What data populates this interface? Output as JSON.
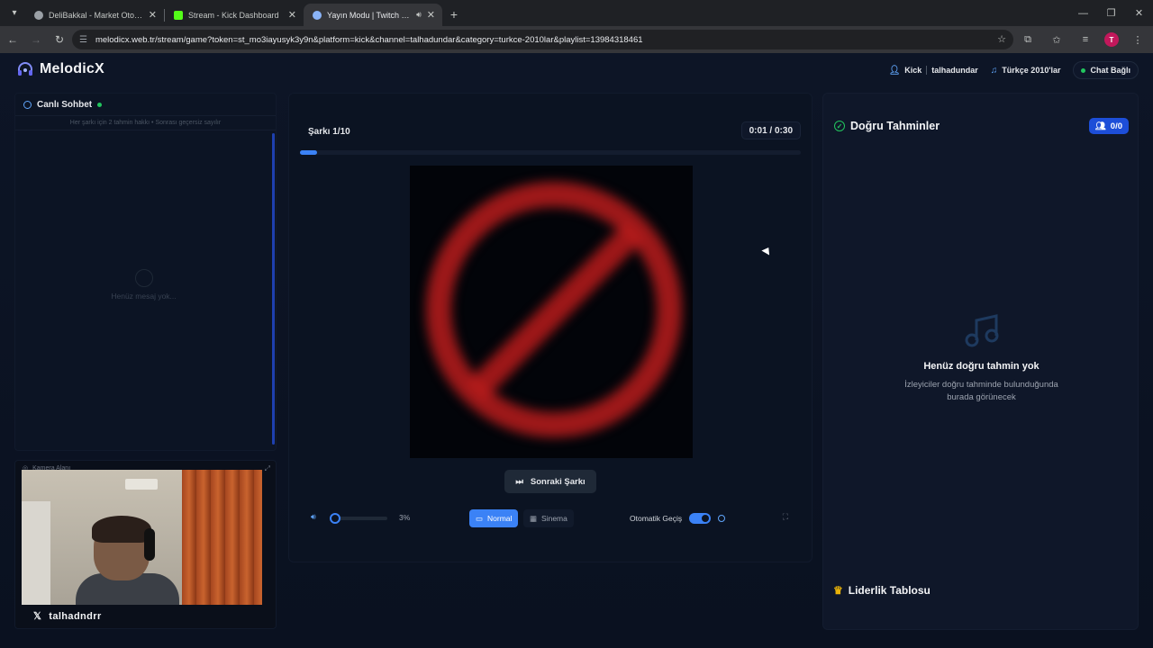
{
  "browser": {
    "tabs": [
      {
        "title": "DeliBakkal - Market Otomasyon",
        "favicon_color": "#9aa0a6",
        "active": false
      },
      {
        "title": "Stream - Kick Dashboard",
        "favicon_color": "#53fc18",
        "active": false
      },
      {
        "title": "Yayın Modu | Twitch ve Kick",
        "favicon_color": "#8ab4f8",
        "active": true
      }
    ],
    "url": "melodicx.web.tr/stream/game?token=st_mo3iayusyk3y9n&platform=kick&channel=talhadundar&category=turkce-2010lar&playlist=13984318461",
    "profile_initial": "T"
  },
  "header": {
    "brand": "MelodicX",
    "platform": "Kick",
    "channel": "talhadundar",
    "category": "Türkçe 2010'lar",
    "chat_status": "Chat Bağlı"
  },
  "chat": {
    "title": "Canlı Sohbet",
    "note": "Her şarkı için 2 tahmin hakkı • Sonrası geçersiz sayılır",
    "empty": "Henüz mesaj yok..."
  },
  "camera": {
    "label": "Kamera Alanı",
    "handle": "talhadndrr"
  },
  "player": {
    "song_counter": "Şarkı 1/10",
    "elapsed": "0:01",
    "total": "0:30",
    "progress": 0.03,
    "next_label": "Sonraki Şarkı",
    "volume_label": "3%",
    "volume": 0.03,
    "mode_normal": "Normal",
    "mode_cinema": "Sinema",
    "auto_label": "Otomatik Geçiş",
    "auto_enabled": true
  },
  "guesses": {
    "title": "Doğru Tahminler",
    "count": "0/0",
    "empty_title": "Henüz doğru tahmin yok",
    "empty_sub": "İzleyiciler doğru tahminde bulunduğunda burada görünecek",
    "leaderboard": "Liderlik Tablosu"
  },
  "colors": {
    "accent": "#3b82f6",
    "success": "#22c55e",
    "gold": "#eab308",
    "cover_symbol": "#b91c1c"
  },
  "icons": {
    "brand": "headphones-icon",
    "cover": "prohibited-icon"
  }
}
